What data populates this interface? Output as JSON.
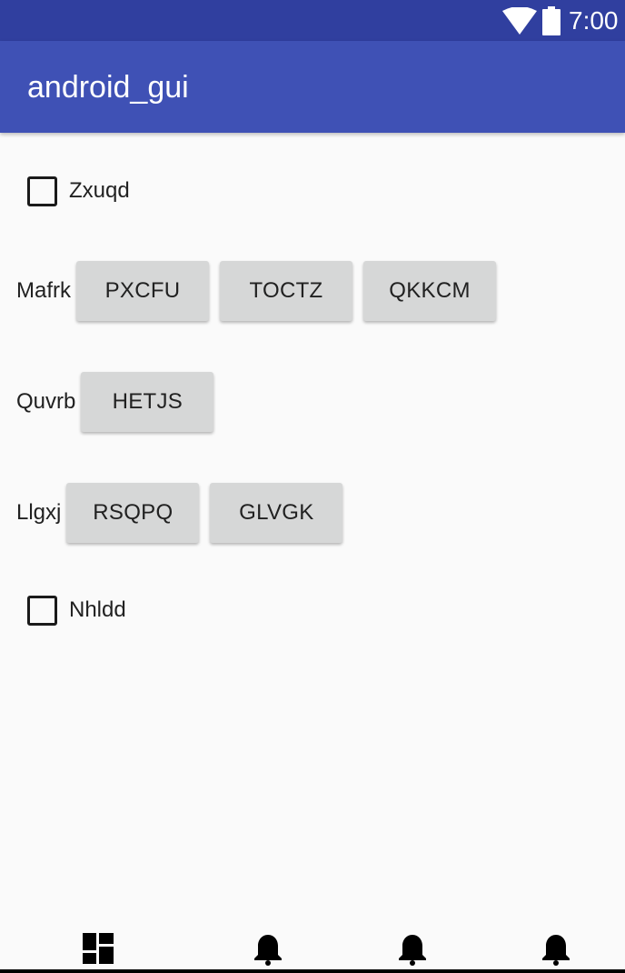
{
  "status_bar": {
    "time": "7:00",
    "icons": [
      "wifi-icon",
      "battery-icon"
    ]
  },
  "app_bar": {
    "title": "android_gui"
  },
  "content": {
    "checkbox_1": {
      "label": "Zxuqd",
      "checked": false
    },
    "row_1": {
      "label": "Mafrk",
      "buttons": [
        "PXCFU",
        "TOCTZ",
        "QKKCM"
      ]
    },
    "row_2": {
      "label": "Quvrb",
      "buttons": [
        "HETJS"
      ]
    },
    "row_3": {
      "label": "Llgxj",
      "buttons": [
        "RSQPQ",
        "GLVGK"
      ]
    },
    "checkbox_2": {
      "label": "Nhldd",
      "checked": false
    }
  },
  "bottom_nav": {
    "items": [
      "dashboard-icon",
      "notifications-icon",
      "notifications-icon",
      "notifications-icon"
    ]
  },
  "colors": {
    "status_bar": "#303f9f",
    "app_bar": "#3f51b5",
    "background": "#fafafa",
    "button": "#d6d7d7"
  }
}
